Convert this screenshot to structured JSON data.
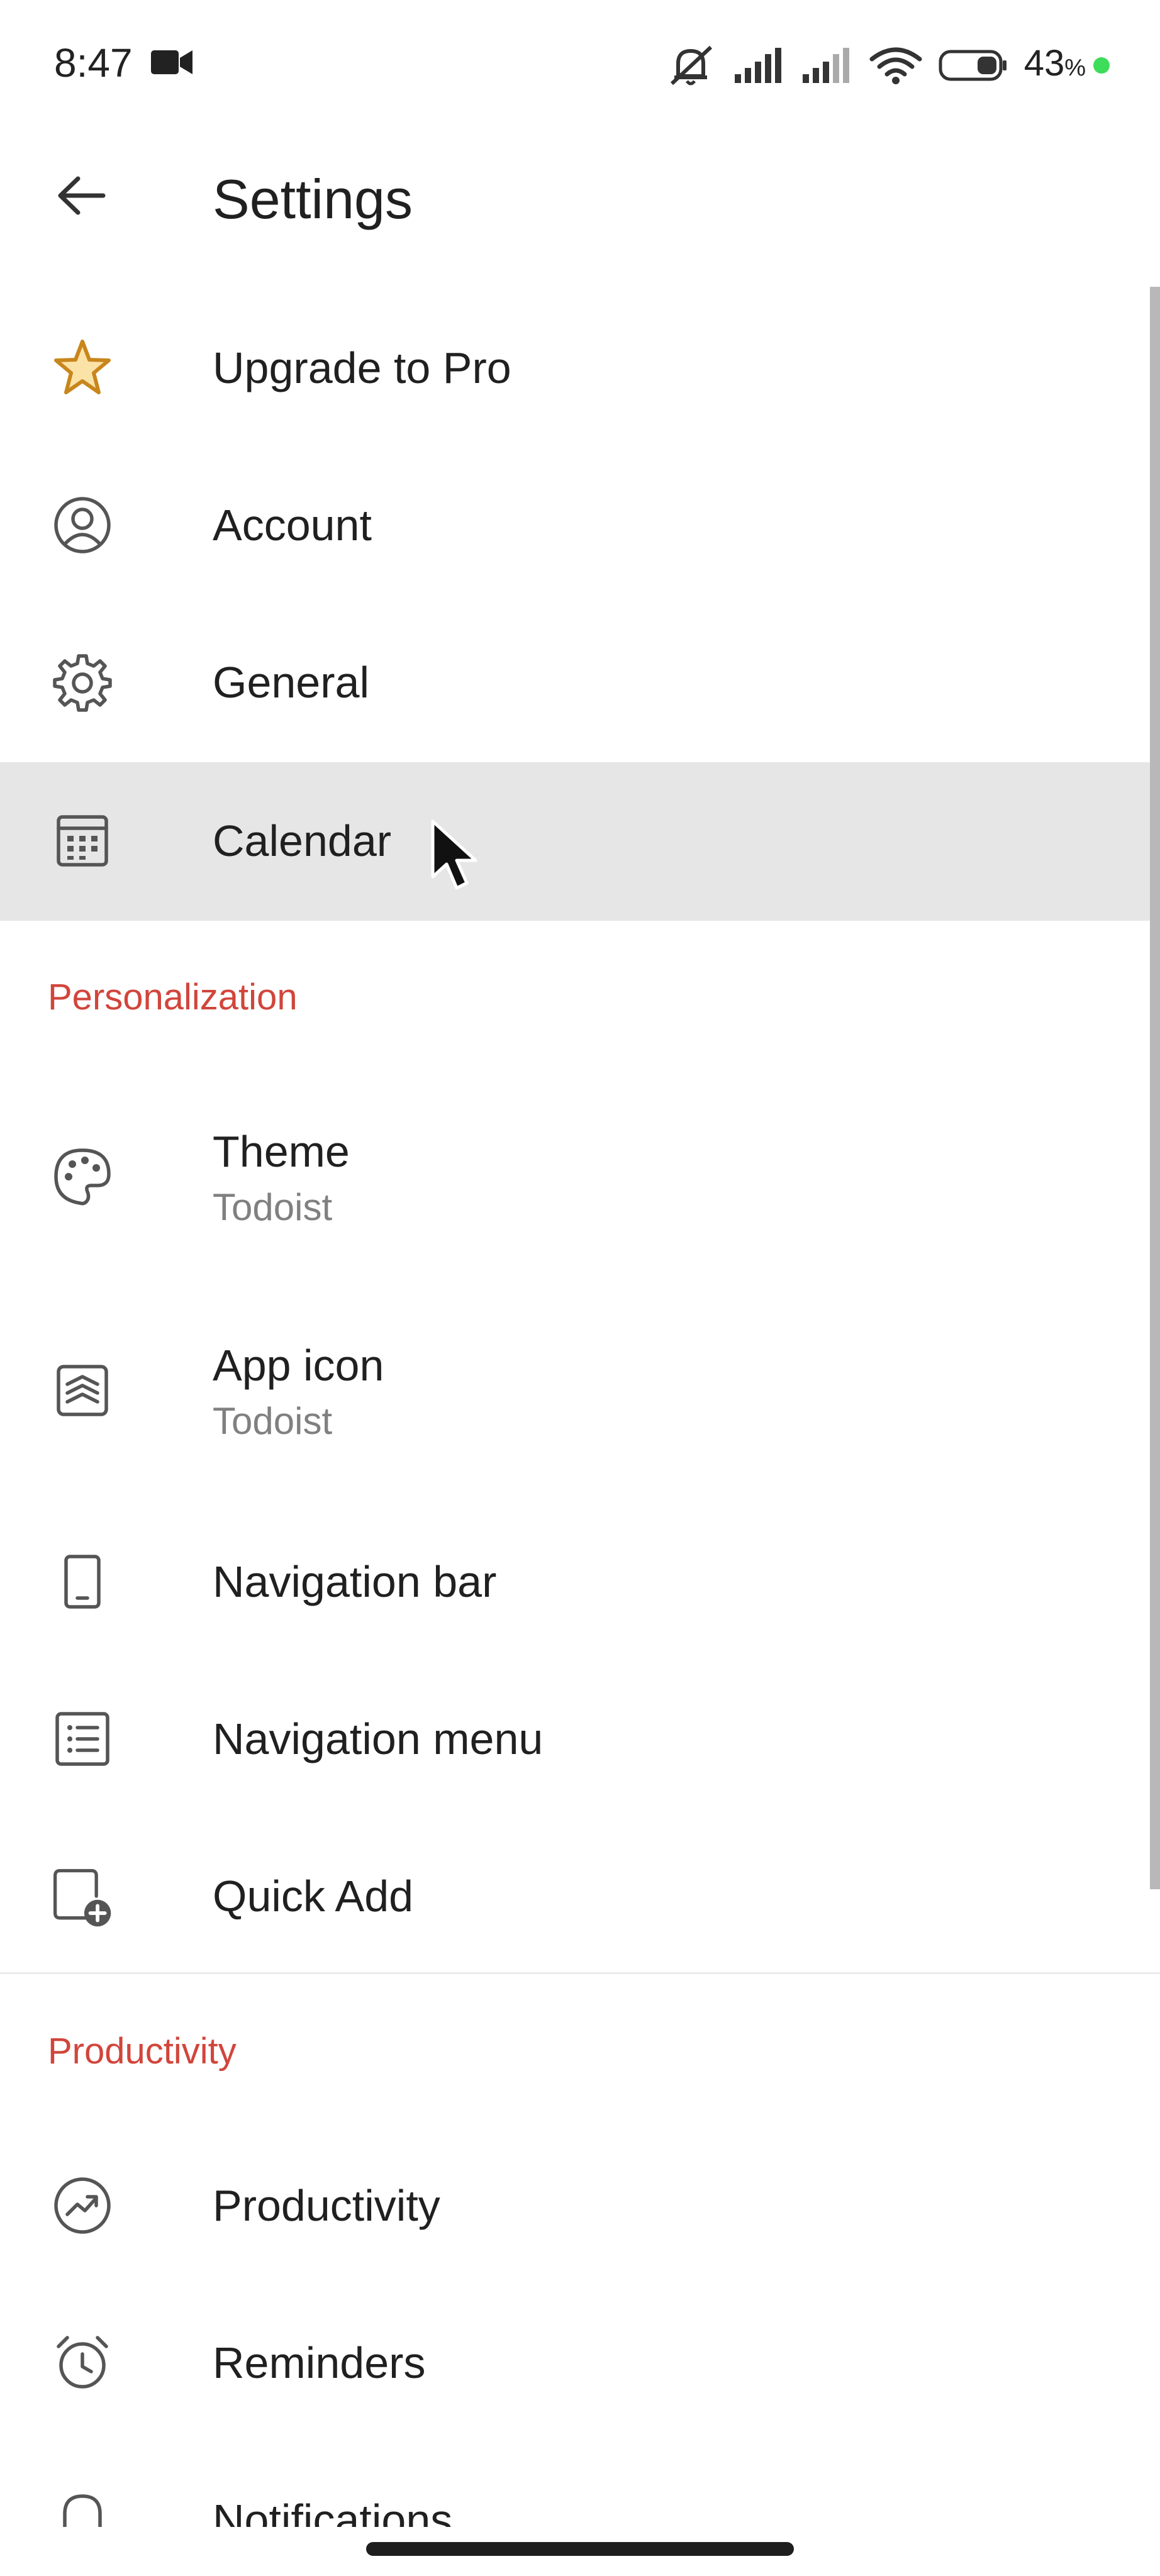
{
  "status_bar": {
    "time": "8:47",
    "battery_percent": "43",
    "battery_unit": "%",
    "battery_level": 0.43,
    "icons": [
      "video-camera-icon",
      "mute-icon",
      "signal-icon",
      "signal-icon",
      "wifi-icon",
      "battery-icon"
    ]
  },
  "header": {
    "title": "Settings",
    "back_icon": "arrow-left-icon"
  },
  "items_top": [
    {
      "label": "Upgrade to Pro",
      "icon": "star-icon"
    },
    {
      "label": "Account",
      "icon": "account-circle-icon"
    },
    {
      "label": "General",
      "icon": "gear-icon"
    },
    {
      "label": "Calendar",
      "icon": "calendar-icon"
    }
  ],
  "sections": {
    "personalization": {
      "title": "Personalization",
      "items": [
        {
          "label": "Theme",
          "value": "Todoist",
          "icon": "palette-icon"
        },
        {
          "label": "App icon",
          "value": "Todoist",
          "icon": "app-icon-icon"
        },
        {
          "label": "Navigation bar",
          "icon": "phone-icon"
        },
        {
          "label": "Navigation menu",
          "icon": "list-icon"
        },
        {
          "label": "Quick Add",
          "icon": "quick-add-icon"
        }
      ]
    },
    "productivity": {
      "title": "Productivity",
      "items": [
        {
          "label": "Productivity",
          "icon": "trend-icon"
        },
        {
          "label": "Reminders",
          "icon": "alarm-icon"
        },
        {
          "label": "Notifications",
          "icon": "bell-icon"
        }
      ]
    }
  },
  "colors": {
    "accent_red": "#d1453b",
    "star_gold": "#c9861d",
    "highlight": "#e6e6e6",
    "text": "#202020",
    "secondary_text": "#808080"
  }
}
